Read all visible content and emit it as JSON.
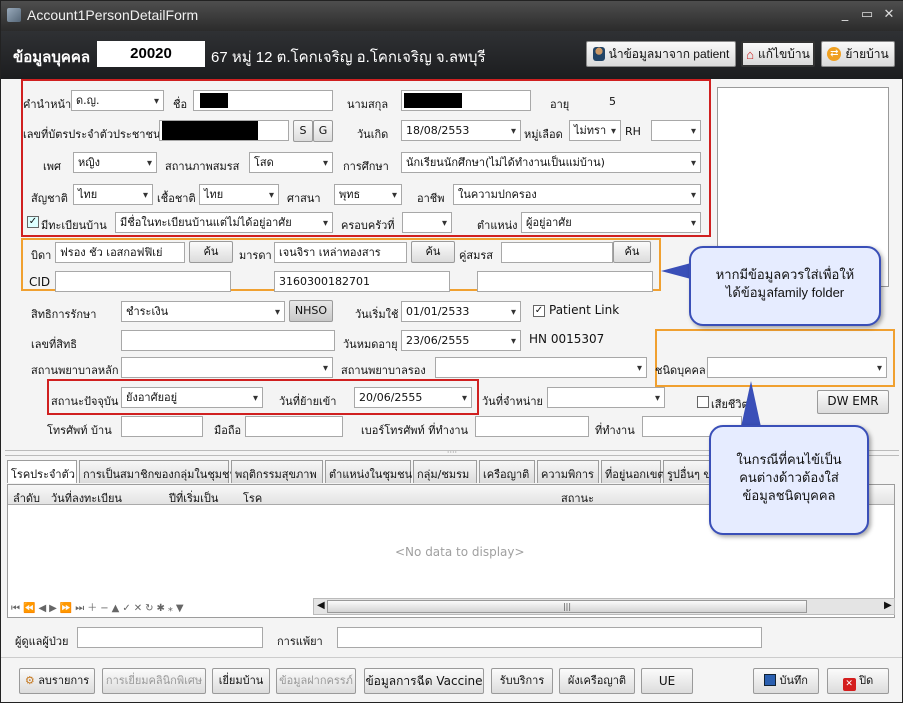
{
  "window": {
    "title": "Account1PersonDetailForm"
  },
  "header": {
    "section_title": "ข้อมูลบุคคล",
    "person_no": "20020",
    "address": "67 หมู่ 12 ต.โคกเจริญ อ.โคกเจริญ จ.ลพบุรี",
    "btn_import": "นำข้อมูลมาจาก patient",
    "btn_edit_house": "แก้ไขบ้าน",
    "btn_move_house": "ย้ายบ้าน"
  },
  "form": {
    "prefix_label": "คำนำหน้า",
    "prefix": "ด.ญ.",
    "fname_label": "ชื่อ",
    "lname_label": "นามสกุล",
    "age_label": "อายุ",
    "age": "5",
    "cid_label": "เลขที่บัตรประจำตัวประชาชน",
    "btn_s": "S",
    "btn_g": "G",
    "birth_label": "วันเกิด",
    "birth": "18/08/2553",
    "blood_label": "หมู่เลือด",
    "blood": "ไม่ทรา",
    "rh_label": "RH",
    "rh": "",
    "sex_label": "เพศ",
    "sex": "หญิง",
    "marital_label": "สถานภาพสมรส",
    "marital": "โสด",
    "edu_label": "การศึกษา",
    "edu": "นักเรียนนักศึกษา(ไม่ได้ทำงานเป็นแม่บ้าน)",
    "nation_label": "สัญชาติ",
    "nation": "ไทย",
    "race_label": "เชื้อชาติ",
    "race": "ไทย",
    "religion_label": "ศาสนา",
    "religion": "พุทธ",
    "occ_label": "อาชีพ",
    "occ": "ในความปกครอง",
    "house_reg_label": "มีทะเบียนบ้าน",
    "house_reg_checked": "✓",
    "house_reg": "มีชื่อในทะเบียนบ้านแต่ไม่ได้อยู่อาศัย",
    "family_label": "ครอบครัวที่",
    "family": "",
    "position_label": "ตำแหน่ง",
    "position": "ผู้อยู่อาศัย",
    "father_label": "บิดา",
    "father": "ฟรอง ชัว เอสกอฟฟิเย่",
    "mother_label": "มารดา",
    "mother": "เจนจิรา เหล่าทองสาร",
    "spouse_label": "คู่สมรส",
    "spouse": "",
    "btn_search": "ค้น",
    "cid2_label": "CID",
    "father_cid": "",
    "mother_cid": "3160300182701",
    "spouse_cid": "",
    "right_label": "สิทธิการรักษา",
    "right": "ชำระเงิน",
    "btn_nhso": "NHSO",
    "start_label": "วันเริ่มใช้",
    "start": "01/01/2533",
    "patient_link": "Patient Link",
    "patient_link_checked": "✓",
    "right_no_label": "เลขที่สิทธิ",
    "expire_label": "วันหมดอายุ",
    "expire": "23/06/2555",
    "hn": "HN  0015307",
    "main_hosp_label": "สถานพยาบาลหลัก",
    "sub_hosp_label": "สถานพยาบาลรอง",
    "ptype_label": "ชนิดบุคคล",
    "ptype": "",
    "status_label": "สถานะปัจจุบัน",
    "status": "ยังอาศัยอยู่",
    "movein_label": "วันที่ย้ายเข้า",
    "movein": "20/06/2555",
    "discharge_label": "วันที่จำหน่าย",
    "discharge": "",
    "dead_label": "เสียชีวิต",
    "btn_dw_emr": "DW EMR",
    "phone_home_label": "โทรศัพท์ บ้าน",
    "mobile_label": "มือถือ",
    "phone_work_label": "เบอร์โทรศัพท์ ที่ทำงาน",
    "work_label": "ที่ทำงาน"
  },
  "bubbles": {
    "family": [
      "หากมีข้อมูลควรใส่เพื่อให้",
      "ได้ข้อมูลfamily folder"
    ],
    "ptype": [
      "ในกรณีที่คนไข้เป็น",
      "คนต่างด้าวต้องใส่",
      "ข้อมูลชนิดบุคคล"
    ]
  },
  "tabs": [
    "โรคประจำตัว",
    "การเป็นสมาชิกของกลุ่มในชุมชน",
    "พฤติกรรมสุขภาพ",
    "ตำแหน่งในชุมชน",
    "กลุ่ม/ชมรม",
    "เครือญาติ",
    "ความพิการ",
    "ที่อยู่นอกเขต",
    "รูปอื่นๆ ของ"
  ],
  "grid": {
    "headers": [
      "ลำดับ",
      "วันที่ลงทะเบียน",
      "ปีที่เริ่มเป็น",
      "โรค",
      "สถานะ"
    ],
    "empty": "<No data to display>"
  },
  "bottom": {
    "caregiver_label": "ผู้ดูแลผู้ป่วย",
    "allergy_label": "การแพ้ยา"
  },
  "footer": {
    "btn_delete": "ลบรายการ",
    "btn_special": "การเยี่ยมคลินิกพิเศษ",
    "btn_visit": "เยี่ยมบ้าน",
    "btn_pregnant": "ข้อมูลฝากครรภ์",
    "btn_vaccine": "ข้อมูลการฉีด Vaccine",
    "btn_service": "รับบริการ",
    "btn_tree": "ผังเครือญาติ",
    "btn_ue": "UE",
    "btn_save": "บันทึก",
    "btn_close": "ปิด"
  }
}
